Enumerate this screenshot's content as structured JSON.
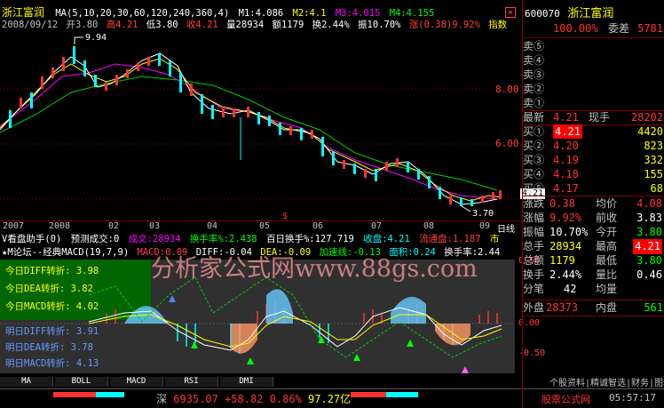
{
  "window_close": "×",
  "stock": {
    "name": "浙江富润",
    "code": "600070",
    "wei_cha_label": "委差",
    "wei_cha": "5781",
    "wei_bi": "100.00%"
  },
  "header": {
    "ma_line": "MA(5,10,20,30,60,120,240,360,4)",
    "m1": "M1:4.086",
    "m2": "M2:4.1",
    "m3": "M3:4.015",
    "m4": "M4:4.155",
    "date": "2008/09/12",
    "open": "开3.80",
    "high": "高4.21",
    "low": "低3.80",
    "close": "收4.21",
    "volume": "量28934",
    "amount": "额1179",
    "turnover": "换2.44%",
    "amplitude": "振10.70%",
    "change": "涨(0.38)9.92%",
    "index_label": "指数"
  },
  "price_axis": [
    "8.00",
    "6.00",
    "4.21",
    "3.70"
  ],
  "annotations": {
    "peak": "9.94",
    "low": "3.70",
    "current": "4.21"
  },
  "time_axis": [
    "2007",
    "2008",
    "02",
    "03",
    "04",
    "05",
    "06",
    "07",
    "08",
    "09"
  ],
  "period_label": "日线",
  "volume_panel": {
    "title": "V看盘助手(0)",
    "predict": "预测成交:0",
    "vol": "成交:28934",
    "turnover": "换手率%:2.438",
    "hundred": "百日换手%:127.719",
    "shou_pan": "收盘:4.21",
    "float_cap": "流通盘:1.187",
    "market": "市"
  },
  "macd_panel": {
    "title": "★M论坛--经典MACD(19,7,9)",
    "macd": "MACD:0.09",
    "diff": "DIFF:-0.04",
    "dea": "DEA:-0.09",
    "accel": "加速线:-0.13",
    "area": "面积:0.24",
    "turnover": "换手率:2.44",
    "watermark": "分析家公式网www.88gs.com",
    "today_diff": "今日DIFF转折: 3.98",
    "today_dea": "今日DEA转折: 3.82",
    "today_macd": "今日MACD转折: 4.02",
    "tom_diff": "明日DIFF转折: 3.91",
    "tom_dea": "明日DEA转折: 3.78",
    "tom_macd": "明日MACD转折: 4.13",
    "axis": [
      "0.50",
      "0.00",
      "-0.50"
    ]
  },
  "tabs": [
    "MA",
    "BOLL",
    "MACD",
    "RSI",
    "DMI"
  ],
  "status": {
    "index_name": "深",
    "index_value": "6935.07",
    "index_change": "+58.82",
    "index_pct": "0.86%",
    "index_amount": "97.27亿",
    "ad": "股票公式网",
    "time": "05:57:17"
  },
  "orderbook": {
    "sells": [
      {
        "label": "卖⑤",
        "price": "",
        "vol": ""
      },
      {
        "label": "卖④",
        "price": "",
        "vol": ""
      },
      {
        "label": "卖③",
        "price": "",
        "vol": ""
      },
      {
        "label": "卖②",
        "price": "",
        "vol": ""
      },
      {
        "label": "卖①",
        "price": "",
        "vol": ""
      }
    ],
    "latest_label": "最新",
    "latest": "4.21",
    "xianshou_label": "现手",
    "xianshou": "28202",
    "buys": [
      {
        "label": "买①",
        "price": "4.21",
        "vol": "4420"
      },
      {
        "label": "买②",
        "price": "4.20",
        "vol": "823"
      },
      {
        "label": "买③",
        "price": "4.19",
        "vol": "332"
      },
      {
        "label": "买④",
        "price": "4.18",
        "vol": "155"
      },
      {
        "label": "买⑤",
        "price": "4.17",
        "vol": "68"
      }
    ]
  },
  "stats": [
    {
      "l1": "涨跌",
      "v1": "0.38",
      "l2": "均价",
      "v2": "4.08"
    },
    {
      "l1": "涨幅",
      "v1": "9.92%",
      "l2": "前收",
      "v2": "3.83"
    },
    {
      "l1": "振幅",
      "v1": "10.70%",
      "l2": "今开",
      "v2": "3.80"
    },
    {
      "l1": "总手",
      "v1": "28934",
      "l2": "最高",
      "v2": "4.21"
    },
    {
      "l1": "总额",
      "v1": "1179",
      "l2": "最低",
      "v2": "3.80"
    },
    {
      "l1": "换手",
      "v1": "2.44%",
      "l2": "量比",
      "v2": "0.46"
    },
    {
      "l1": "分笔",
      "v1": "42",
      "l2": "均量",
      "v2": ""
    }
  ],
  "outer": {
    "wai_label": "外盘",
    "wai": "28373",
    "nei_label": "内盘",
    "nei": "561"
  },
  "right_bottom_text": "个股资料|精诚智选|财务|图表|软件",
  "colors": {
    "up": "#ff3232",
    "down": "#00ffff",
    "bg": "#000000",
    "frame": "#800000"
  }
}
